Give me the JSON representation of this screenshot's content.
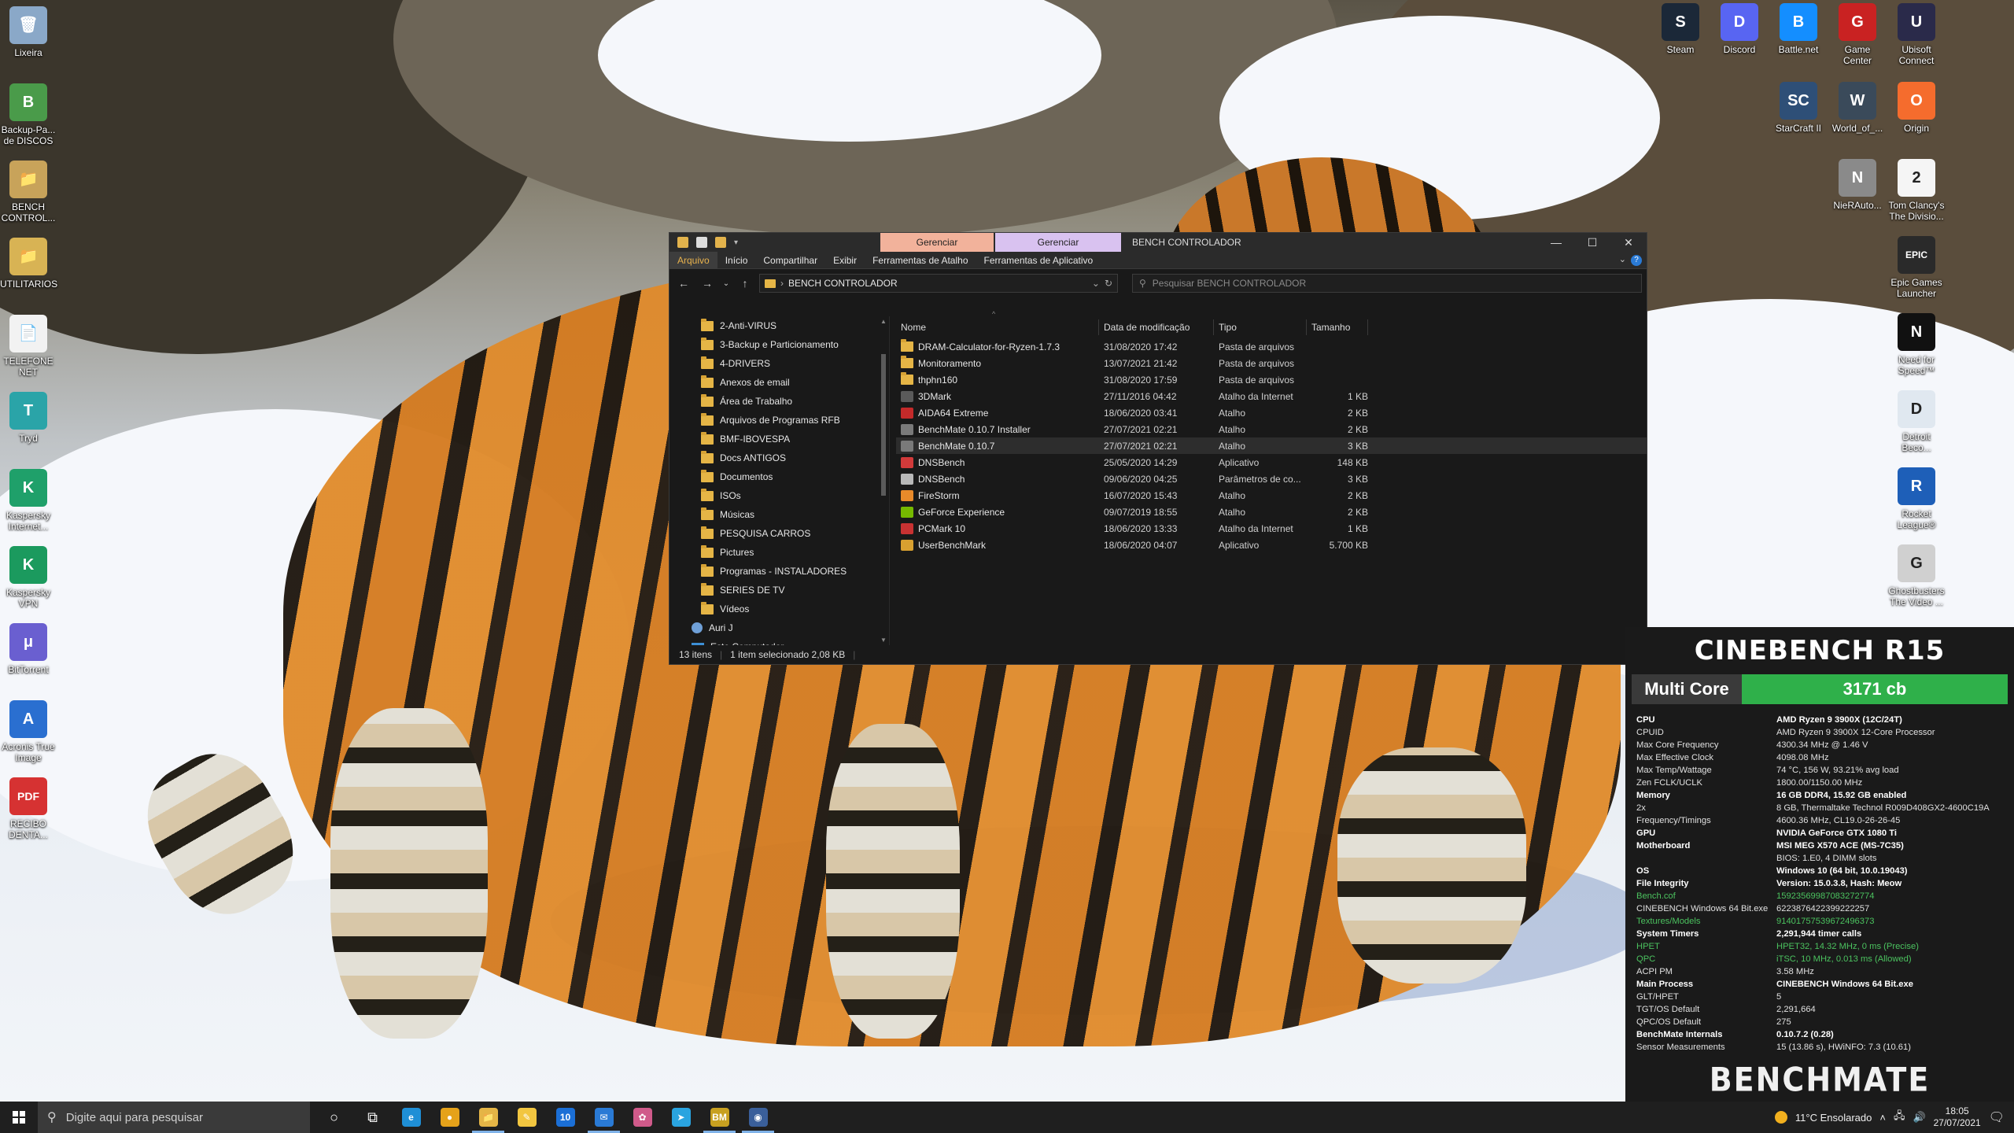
{
  "desktop_left": [
    {
      "label": "Lixeira",
      "color": "#8aa8c8",
      "glyph": "🗑"
    },
    {
      "label": "Backup-Pa... de DISCOS",
      "color": "#4a9b4a",
      "glyph": "B"
    },
    {
      "label": "BENCH CONTROL...",
      "color": "#c8a35a",
      "glyph": "📁"
    },
    {
      "label": "UTILITARIOS",
      "color": "#d8b354",
      "glyph": "📁"
    },
    {
      "label": "TELEFONE NET",
      "color": "#f2f2f2",
      "glyph": "📄"
    },
    {
      "label": "Tryd",
      "color": "#2aa4a8",
      "glyph": "T"
    },
    {
      "label": "Kaspersky Internet...",
      "color": "#1fa06a",
      "glyph": "K"
    },
    {
      "label": "Kaspersky VPN",
      "color": "#1b9a5e",
      "glyph": "K"
    },
    {
      "label": "BitTorrent",
      "color": "#6a5fd0",
      "glyph": "μ"
    },
    {
      "label": "Acronis True Image",
      "color": "#2a6fd0",
      "glyph": "A"
    },
    {
      "label": "RECIBO DENTA...",
      "color": "#d63232",
      "glyph": "PDF"
    }
  ],
  "desktop_right": [
    {
      "label": "Steam",
      "color": "#1b2838",
      "glyph": "S"
    },
    {
      "label": "Discord",
      "color": "#5865f2",
      "glyph": "D"
    },
    {
      "label": "Battle.net",
      "color": "#148eff",
      "glyph": "B"
    },
    {
      "label": "Game Center",
      "color": "#c92222",
      "glyph": "G"
    },
    {
      "label": "Ubisoft Connect",
      "color": "#2a2a4a",
      "glyph": "U"
    },
    {
      "label": "StarCraft II",
      "color": "#2e4f77",
      "glyph": "SC"
    },
    {
      "label": "World_of_...",
      "color": "#3a4a5a",
      "glyph": "W"
    },
    {
      "label": "Origin",
      "color": "#f56c2d",
      "glyph": "O"
    },
    {
      "label": "NieRAuto...",
      "color": "#8a8a8a",
      "glyph": "N"
    },
    {
      "label": "Tom Clancy's The Divisio...",
      "color": "#f5f5f5",
      "glyph": "2"
    },
    {
      "label": "Epic Games Launcher",
      "color": "#2a2a2a",
      "glyph": "EPIC"
    },
    {
      "label": "Need for Speed™",
      "color": "#111111",
      "glyph": "N"
    },
    {
      "label": "Detroit Beco...",
      "color": "#e0e8f0",
      "glyph": "D"
    },
    {
      "label": "Rocket League®",
      "color": "#1e5fb8",
      "glyph": "R"
    },
    {
      "label": "Ghostbusters The Video ...",
      "color": "#d0d0d0",
      "glyph": "G"
    }
  ],
  "explorer": {
    "ctx_tab1": "Gerenciar",
    "ctx_tab2": "Gerenciar",
    "title": "BENCH CONTROLADOR",
    "ribbon_tabs": [
      "Arquivo",
      "Início",
      "Compartilhar",
      "Exibir",
      "Ferramentas de Atalho",
      "Ferramentas de Aplicativo"
    ],
    "address": "BENCH CONTROLADOR",
    "search_placeholder": "Pesquisar BENCH CONTROLADOR",
    "nav_items": [
      "2-Anti-VIRUS",
      "3-Backup e Particionamento",
      "4-DRIVERS",
      "Anexos de email",
      "Área de Trabalho",
      "Arquivos de Programas RFB",
      "BMF-IBOVESPA",
      "Docs ANTIGOS",
      "Documentos",
      "ISOs",
      "Músicas",
      "PESQUISA CARROS",
      "Pictures",
      "Programas - INSTALADORES",
      "SERIES DE TV",
      "Vídeos"
    ],
    "nav_user": "Auri J",
    "nav_pc": "Este Computador",
    "columns": [
      "Nome",
      "Data de modificação",
      "Tipo",
      "Tamanho"
    ],
    "files": [
      {
        "name": "DRAM-Calculator-for-Ryzen-1.7.3",
        "date": "31/08/2020 17:42",
        "type": "Pasta de arquivos",
        "size": "",
        "color": "#e5b546"
      },
      {
        "name": "Monitoramento",
        "date": "13/07/2021 21:42",
        "type": "Pasta de arquivos",
        "size": "",
        "color": "#e5b546"
      },
      {
        "name": "thphn160",
        "date": "31/08/2020 17:59",
        "type": "Pasta de arquivos",
        "size": "",
        "color": "#e5b546"
      },
      {
        "name": "3DMark",
        "date": "27/11/2016 04:42",
        "type": "Atalho da Internet",
        "size": "1 KB",
        "color": "#5a5a5a"
      },
      {
        "name": "AIDA64 Extreme",
        "date": "18/06/2020 03:41",
        "type": "Atalho",
        "size": "2 KB",
        "color": "#c42a2a"
      },
      {
        "name": "BenchMate 0.10.7 Installer",
        "date": "27/07/2021 02:21",
        "type": "Atalho",
        "size": "2 KB",
        "color": "#7a7a7a"
      },
      {
        "name": "BenchMate 0.10.7",
        "date": "27/07/2021 02:21",
        "type": "Atalho",
        "size": "3 KB",
        "color": "#7a7a7a"
      },
      {
        "name": "DNSBench",
        "date": "25/05/2020 14:29",
        "type": "Aplicativo",
        "size": "148 KB",
        "color": "#d23a3a"
      },
      {
        "name": "DNSBench",
        "date": "09/06/2020 04:25",
        "type": "Parâmetros de co...",
        "size": "3 KB",
        "color": "#b8b8b8"
      },
      {
        "name": "FireStorm",
        "date": "16/07/2020 15:43",
        "type": "Atalho",
        "size": "2 KB",
        "color": "#e88a2a"
      },
      {
        "name": "GeForce Experience",
        "date": "09/07/2019 18:55",
        "type": "Atalho",
        "size": "2 KB",
        "color": "#76b900"
      },
      {
        "name": "PCMark 10",
        "date": "18/06/2020 13:33",
        "type": "Atalho da Internet",
        "size": "1 KB",
        "color": "#c83232"
      },
      {
        "name": "UserBenchMark",
        "date": "18/06/2020 04:07",
        "type": "Aplicativo",
        "size": "5.700 KB",
        "color": "#d8a030"
      }
    ],
    "selected_index": 6,
    "status_count": "13 itens",
    "status_selected": "1 item selecionado  2,08 KB"
  },
  "benchmate": {
    "title": "CINEBENCH R15",
    "score_label": "Multi Core",
    "score_value": "3171 cb",
    "rows": [
      {
        "k": "CPU",
        "v": "AMD Ryzen 9 3900X (12C/24T)",
        "style": "b"
      },
      {
        "k": "CPUID",
        "v": "AMD Ryzen 9 3900X 12-Core Processor",
        "style": ""
      },
      {
        "k": "Max Core Frequency",
        "v": "4300.34 MHz @ 1.46 V",
        "style": ""
      },
      {
        "k": "Max Effective Clock",
        "v": "4098.08 MHz",
        "style": ""
      },
      {
        "k": "Max Temp/Wattage",
        "v": "74 °C, 156 W, 93.21% avg load",
        "style": ""
      },
      {
        "k": "Zen FCLK/UCLK",
        "v": "1800.00/1150.00 MHz",
        "style": ""
      },
      {
        "k": "Memory",
        "v": "16 GB DDR4, 15.92 GB enabled",
        "style": "b"
      },
      {
        "k": "2x",
        "v": "8 GB, Thermaltake Technol R009D408GX2-4600C19A",
        "style": ""
      },
      {
        "k": "Frequency/Timings",
        "v": "4600.36 MHz, CL19.0-26-26-45",
        "style": ""
      },
      {
        "k": "GPU",
        "v": "NVIDIA GeForce GTX 1080 Ti",
        "style": "b"
      },
      {
        "k": "Motherboard",
        "v": "MSI MEG X570 ACE (MS-7C35)",
        "style": "b"
      },
      {
        "k": "",
        "v": "BIOS: 1.E0, 4 DIMM slots",
        "style": ""
      },
      {
        "k": "OS",
        "v": "Windows 10 (64 bit, 10.0.19043)",
        "style": "b"
      },
      {
        "k": "File Integrity",
        "v": "Version: 15.0.3.8, Hash: Meow",
        "style": "b"
      },
      {
        "k": "Bench.cof",
        "v": "15923569987083272774",
        "style": "g"
      },
      {
        "k": "CINEBENCH Windows 64 Bit.exe",
        "v": "6223876422399222257",
        "style": ""
      },
      {
        "k": "Textures/Models",
        "v": "914017575396724963​73",
        "style": "g"
      },
      {
        "k": "System Timers",
        "v": "2,291,944 timer calls",
        "style": "b"
      },
      {
        "k": "HPET",
        "v": "HPET32, 14.32 MHz, 0 ms (Precise)",
        "style": "g"
      },
      {
        "k": "QPC",
        "v": "iTSC, 10 MHz, 0.013 ms (Allowed)",
        "style": "g"
      },
      {
        "k": "ACPI PM",
        "v": "3.58 MHz",
        "style": ""
      },
      {
        "k": "Main Process",
        "v": "CINEBENCH Windows 64 Bit.exe",
        "style": "b"
      },
      {
        "k": "GLT/HPET",
        "v": "5",
        "style": ""
      },
      {
        "k": "TGT/OS Default",
        "v": "2,291,664",
        "style": ""
      },
      {
        "k": "QPC/OS Default",
        "v": "275",
        "style": ""
      },
      {
        "k": "BenchMate Internals",
        "v": "0.10.7.2 (0.28)",
        "style": "b"
      },
      {
        "k": "Sensor Measurements",
        "v": "15 (13.86 s), HWiNFO: 7.3 (10.61)",
        "style": ""
      }
    ],
    "logo": "BENCHMATE"
  },
  "taskbar": {
    "search_placeholder": "Digite aqui para pesquisar",
    "apps": [
      {
        "name": "cortana",
        "glyph": "○",
        "color": "transparent"
      },
      {
        "name": "task-view",
        "glyph": "⧉",
        "color": "transparent"
      },
      {
        "name": "edge",
        "glyph": "e",
        "color": "#1f8fd6"
      },
      {
        "name": "chrome",
        "glyph": "●",
        "color": "#e5a21a"
      },
      {
        "name": "file-explorer",
        "glyph": "📁",
        "color": "#e5b546"
      },
      {
        "name": "notes",
        "glyph": "✎",
        "color": "#f2c640"
      },
      {
        "name": "calendar",
        "glyph": "10",
        "color": "#1b6fd6"
      },
      {
        "name": "mail",
        "glyph": "✉",
        "color": "#2a7ad5"
      },
      {
        "name": "paint",
        "glyph": "✿",
        "color": "#d05a8a"
      },
      {
        "name": "telegram",
        "glyph": "➤",
        "color": "#2aa4e0"
      },
      {
        "name": "benchmate",
        "glyph": "BM",
        "color": "#c8a020"
      },
      {
        "name": "cinebench",
        "glyph": "◉",
        "color": "#3a5f9a"
      }
    ],
    "weather": "11°C  Ensolarado",
    "time": "18:05",
    "date": "27/07/2021"
  }
}
